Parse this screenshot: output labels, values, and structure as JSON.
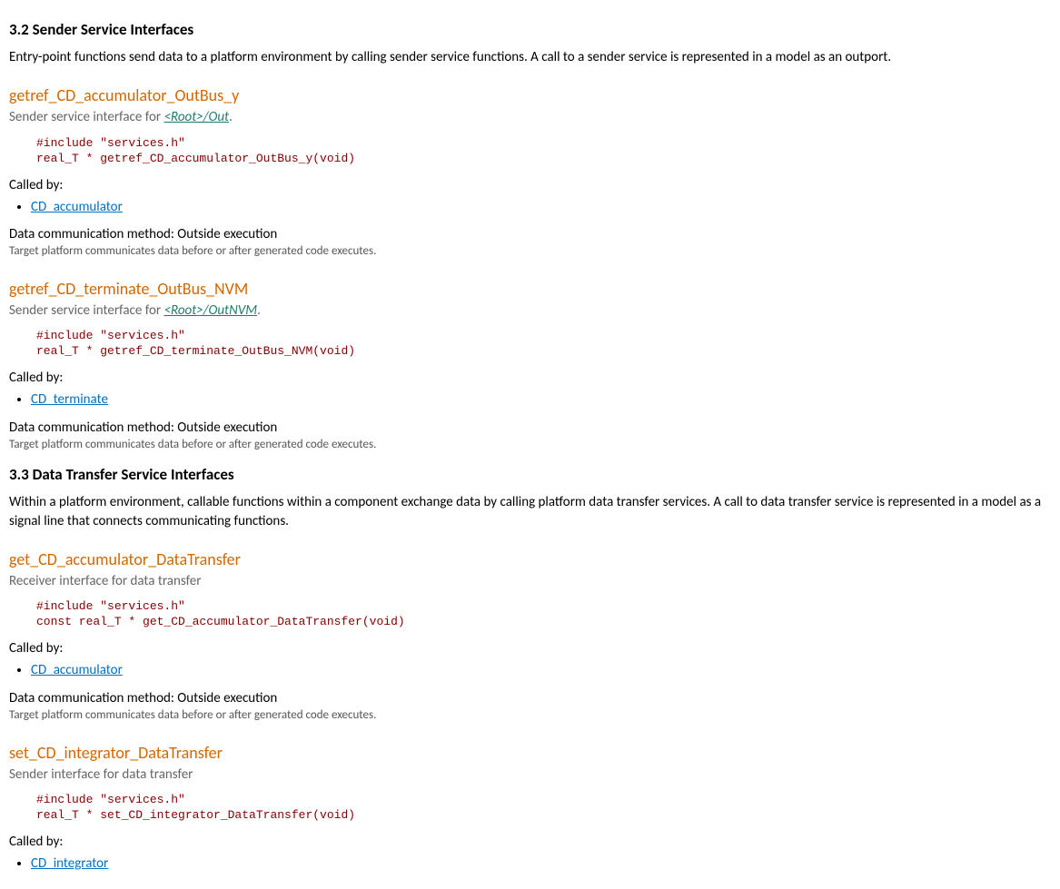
{
  "section32": {
    "heading": "3.2 Sender Service Interfaces",
    "intro": "Entry-point functions send data to a platform environment by calling sender service functions. A call to a sender service is represented in a model as an outport."
  },
  "fn1": {
    "title": "getref_CD_accumulator_OutBus_y",
    "desc_prefix": "Sender service interface for ",
    "desc_link": "<Root>/Out",
    "desc_suffix": ".",
    "code": "#include \"services.h\"\nreal_T * getref_CD_accumulator_OutBus_y(void)",
    "called_by_label": "Called by:",
    "caller": "CD_accumulator",
    "dcm": "Data communication method: Outside execution",
    "dcm_sub": "Target platform communicates data before or after generated code executes."
  },
  "fn2": {
    "title": "getref_CD_terminate_OutBus_NVM",
    "desc_prefix": "Sender service interface for ",
    "desc_link": "<Root>/OutNVM",
    "desc_suffix": ".",
    "code": "#include \"services.h\"\nreal_T * getref_CD_terminate_OutBus_NVM(void)",
    "called_by_label": "Called by:",
    "caller": "CD_terminate",
    "dcm": "Data communication method: Outside execution",
    "dcm_sub": "Target platform communicates data before or after generated code executes."
  },
  "section33": {
    "heading": "3.3 Data Transfer Service Interfaces",
    "intro": "Within a platform environment, callable functions within a component exchange data by calling platform data transfer services. A call to data transfer service is represented in a model as a signal line that connects communicating functions."
  },
  "fn3": {
    "title": "get_CD_accumulator_DataTransfer",
    "desc": "Receiver interface for data transfer",
    "code": "#include \"services.h\"\nconst real_T * get_CD_accumulator_DataTransfer(void)",
    "called_by_label": "Called by:",
    "caller": "CD_accumulator",
    "dcm": "Data communication method: Outside execution",
    "dcm_sub": "Target platform communicates data before or after generated code executes."
  },
  "fn4": {
    "title": "set_CD_integrator_DataTransfer",
    "desc": "Sender interface for data transfer",
    "code": "#include \"services.h\"\nreal_T * set_CD_integrator_DataTransfer(void)",
    "called_by_label": "Called by:",
    "caller": "CD_integrator"
  }
}
